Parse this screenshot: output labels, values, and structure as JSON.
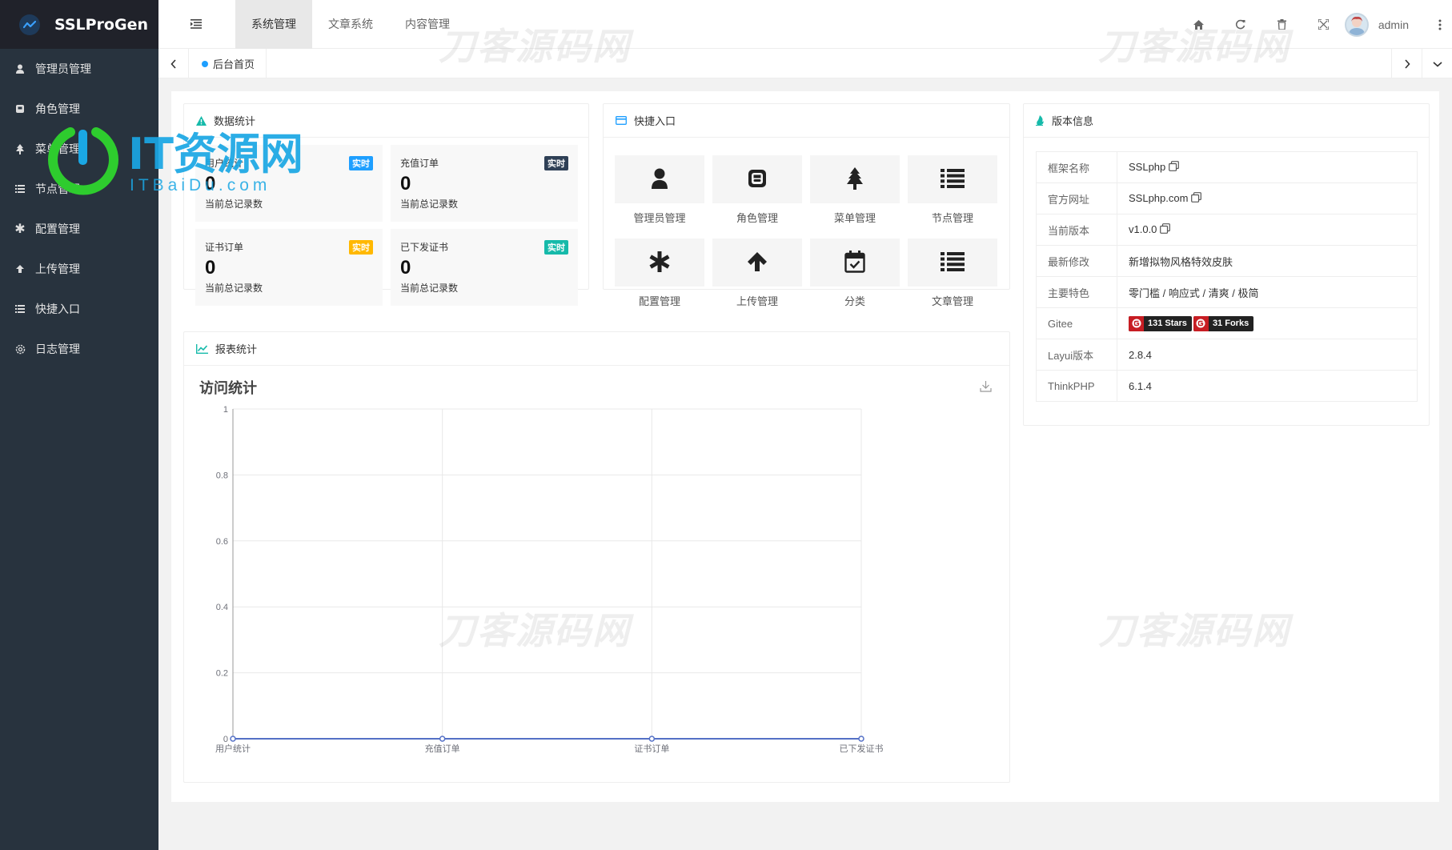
{
  "app": {
    "name": "SSLProGen"
  },
  "sidebar": {
    "items": [
      {
        "label": "管理员管理",
        "icon": "user-icon"
      },
      {
        "label": "角色管理",
        "icon": "role-icon"
      },
      {
        "label": "菜单管理",
        "icon": "tree-icon"
      },
      {
        "label": "节点管理",
        "icon": "list-icon"
      },
      {
        "label": "配置管理",
        "icon": "asterisk-icon"
      },
      {
        "label": "上传管理",
        "icon": "arrow-up-icon"
      },
      {
        "label": "快捷入口",
        "icon": "list-icon"
      },
      {
        "label": "日志管理",
        "icon": "gear-icon"
      }
    ]
  },
  "header": {
    "tabs": [
      "系统管理",
      "文章系统",
      "内容管理"
    ],
    "active_tab": "系统管理",
    "user": "admin"
  },
  "pagetabs": {
    "home": "后台首页"
  },
  "stats": {
    "title": "数据统计",
    "items": [
      {
        "title": "用户统计",
        "badge": "实时",
        "badge_color": "#1e9fff",
        "value": "0",
        "desc": "当前总记录数"
      },
      {
        "title": "充值订单",
        "badge": "实时",
        "badge_color": "#2f4056",
        "value": "0",
        "desc": "当前总记录数"
      },
      {
        "title": "证书订单",
        "badge": "实时",
        "badge_color": "#ffb800",
        "value": "0",
        "desc": "当前总记录数"
      },
      {
        "title": "已下发证书",
        "badge": "实时",
        "badge_color": "#16baaa",
        "value": "0",
        "desc": "当前总记录数"
      }
    ]
  },
  "quick": {
    "title": "快捷入口",
    "items": [
      {
        "label": "管理员管理",
        "icon": "user-icon"
      },
      {
        "label": "角色管理",
        "icon": "role-icon"
      },
      {
        "label": "菜单管理",
        "icon": "tree-icon"
      },
      {
        "label": "节点管理",
        "icon": "list-icon"
      },
      {
        "label": "配置管理",
        "icon": "asterisk-icon"
      },
      {
        "label": "上传管理",
        "icon": "arrow-up-icon"
      },
      {
        "label": "分类",
        "icon": "calendar-check-icon"
      },
      {
        "label": "文章管理",
        "icon": "list-icon"
      }
    ]
  },
  "version": {
    "title": "版本信息",
    "rows": [
      {
        "k": "框架名称",
        "v": "SSLphp"
      },
      {
        "k": "官方网址",
        "v": "SSLphp.com"
      },
      {
        "k": "当前版本",
        "v": "v1.0.0"
      },
      {
        "k": "最新修改",
        "v": "新增拟物风格特效皮肤"
      },
      {
        "k": "主要特色",
        "v": "零门槛 / 响应式 / 清爽 / 极简"
      },
      {
        "k": "Gitee",
        "v": ""
      },
      {
        "k": "Layui版本",
        "v": "2.8.4"
      },
      {
        "k": "ThinkPHP",
        "v": "6.1.4"
      }
    ],
    "badges": {
      "stars": "131 Stars",
      "forks": "31 Forks"
    }
  },
  "report": {
    "title": "报表统计",
    "chart_title": "访问统计"
  },
  "chart_data": {
    "type": "line",
    "title": "访问统计",
    "categories": [
      "用户统计",
      "充值订单",
      "证书订单",
      "已下发证书"
    ],
    "values": [
      0,
      0,
      0,
      0
    ],
    "ylim": [
      0,
      1
    ],
    "yticks": [
      "0",
      "0.2",
      "0.4",
      "0.6",
      "0.8",
      "1"
    ],
    "grid": true
  },
  "watermarks": {
    "text": "刀客源码网",
    "logo_big": "IT资源网",
    "logo_small": "ITBaiDu.com"
  },
  "colors": {
    "sidebar": "#28333e",
    "logo_bg": "#20222a",
    "accent": "#1e9fff",
    "gitee": "#c71d23"
  }
}
